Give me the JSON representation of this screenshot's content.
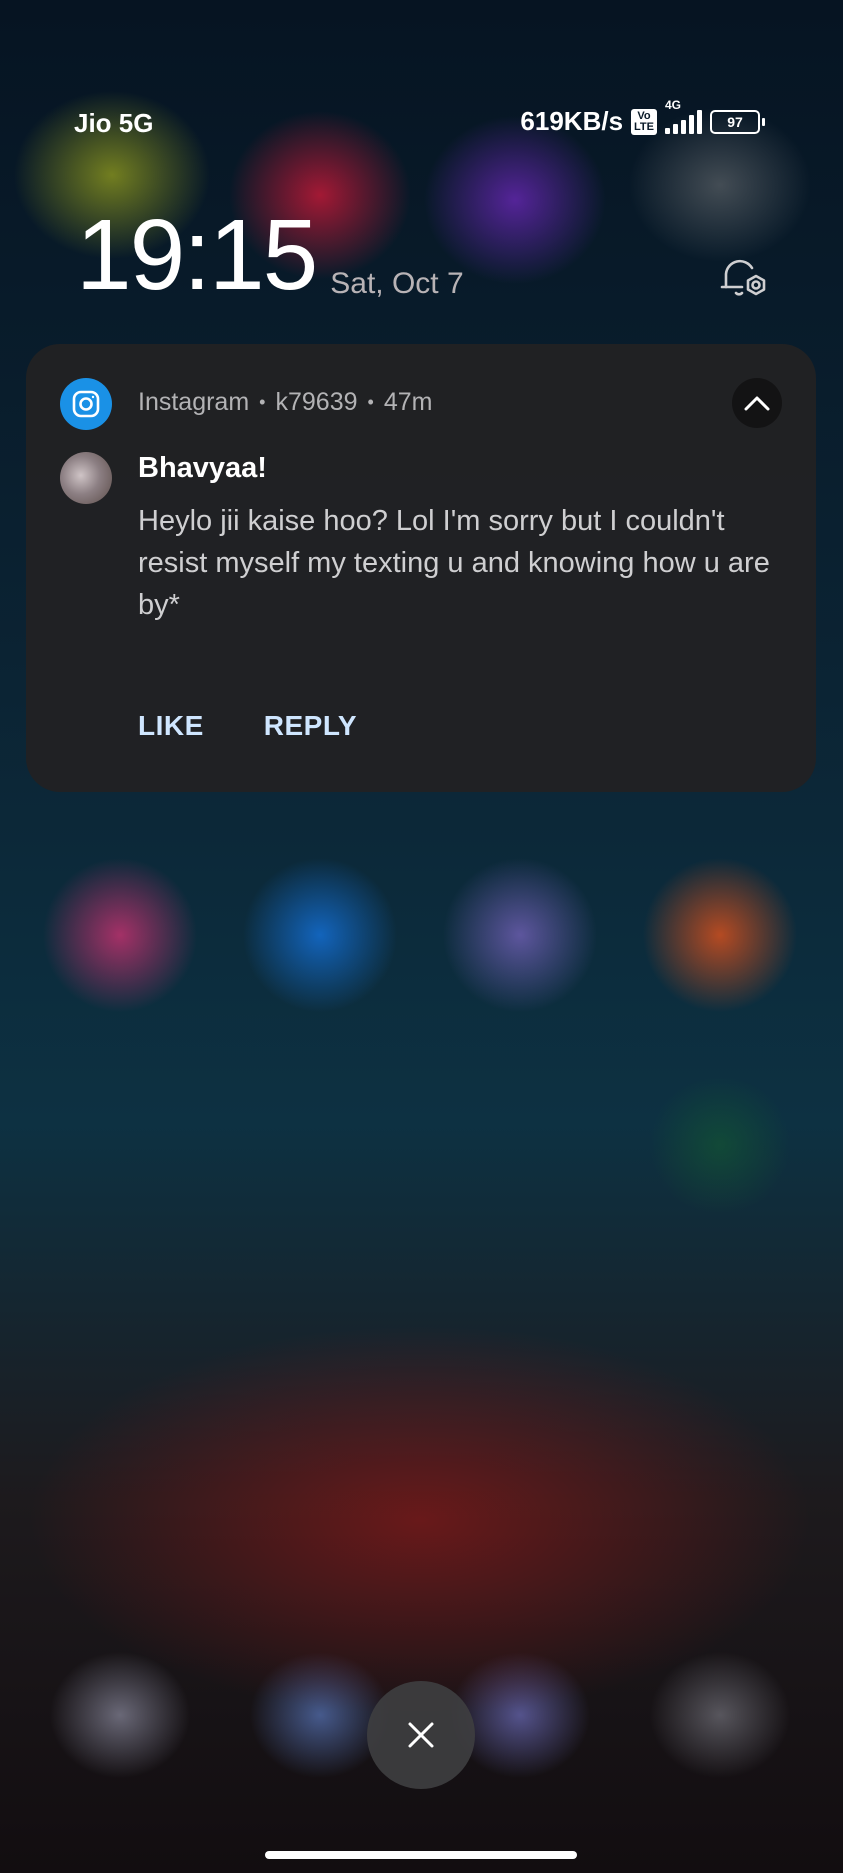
{
  "status_bar": {
    "carrier": "Jio 5G",
    "net_speed": "619KB/s",
    "volte_label": "Vo\nLTE",
    "network_gen": "4G",
    "battery_level": "97"
  },
  "lock_clock": {
    "time": "19:15",
    "date": "Sat, Oct 7"
  },
  "notification": {
    "app_name": "Instagram",
    "account": "k79639",
    "age": "47m",
    "sender": "Bhavyaa!",
    "message": "Heylo jii kaise hoo? Lol I'm sorry but I couldn't resist myself my texting u and knowing how u are\nby*",
    "actions": [
      {
        "label": "LIKE"
      },
      {
        "label": "REPLY"
      }
    ],
    "app_icon": "instagram-icon",
    "accent_color": "#1a91e6",
    "action_color": "#cfe6ff"
  },
  "icons": {
    "bell_settings": "bell-settings-icon",
    "collapse": "chevron-up-icon",
    "close": "close-icon"
  }
}
